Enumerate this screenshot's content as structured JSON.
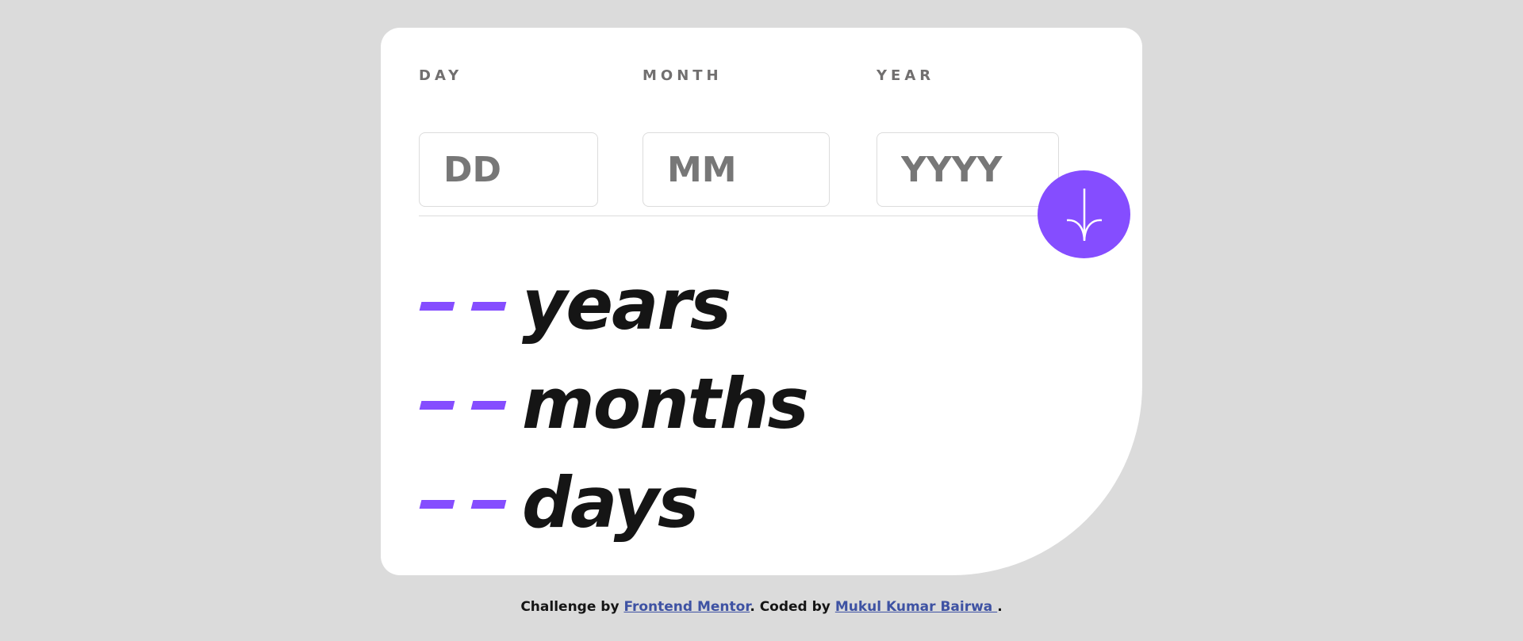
{
  "form": {
    "day": {
      "label": "Day",
      "placeholder": "DD",
      "value": ""
    },
    "month": {
      "label": "Month",
      "placeholder": "MM",
      "value": ""
    },
    "year": {
      "label": "Year",
      "placeholder": "YYYY",
      "value": ""
    },
    "submit_icon": "arrow-down-icon"
  },
  "results": {
    "years": {
      "value": "--",
      "unit": "years"
    },
    "months": {
      "value": "--",
      "unit": "months"
    },
    "days": {
      "value": "--",
      "unit": "days"
    }
  },
  "footer": {
    "prefix": "Challenge by ",
    "link1": "Frontend Mentor",
    "middle": ". Coded by ",
    "link2": "Mukul Kumar Bairwa ",
    "suffix": "."
  },
  "colors": {
    "background": "#dbdbdb",
    "card": "#ffffff",
    "accent": "#854dff",
    "label": "#716f6f",
    "text": "#151515",
    "link": "#3e52a3"
  }
}
